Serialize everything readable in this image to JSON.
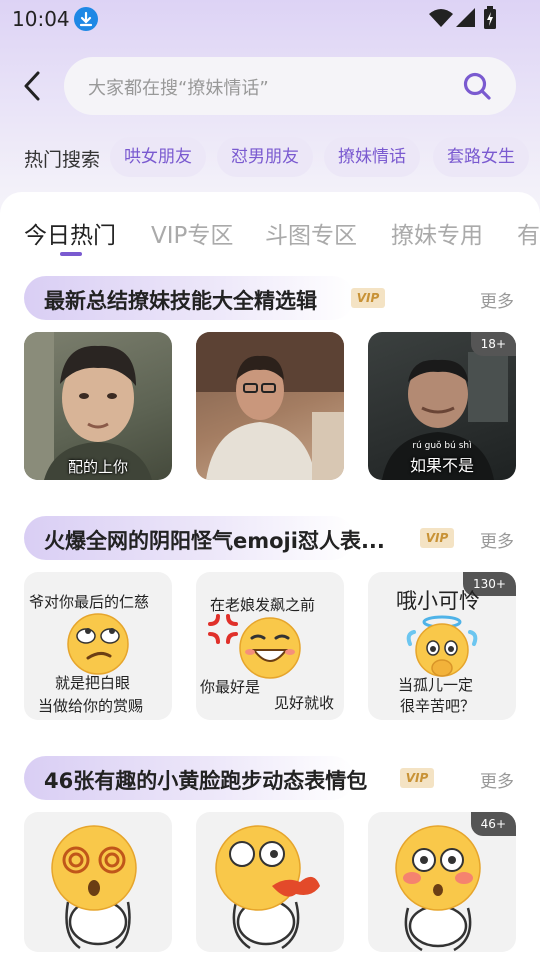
{
  "status": {
    "time": "10:04"
  },
  "search": {
    "placeholder": "大家都在搜“撩妹情话”"
  },
  "hot_search": {
    "label": "热门搜索",
    "tags": [
      "哄女朋友",
      "怼男朋友",
      "撩妹情话",
      "套路女生"
    ]
  },
  "tabs": [
    "今日热门",
    "VIP专区",
    "斗图专区",
    "撩妹专用",
    "有"
  ],
  "sections": [
    {
      "title": "最新总结撩妹技能大全精选辑",
      "vip": "VIP",
      "more": "更多",
      "thumbs": [
        {
          "caption": "配的上你"
        },
        {
          "caption": ""
        },
        {
          "caption": "如果不是",
          "pinyin": "rú   guǒ   bú   shì",
          "count": "18+"
        }
      ]
    },
    {
      "title": "火爆全网的阴阳怪气emoji怼人表...",
      "vip": "VIP",
      "more": "更多",
      "thumbs": [
        {
          "lines": [
            "爷对你最后的仁慈",
            "就是把白眼",
            "当做给你的赏赐"
          ]
        },
        {
          "lines": [
            "在老娘发飙之前",
            "你最好是",
            "见好就收"
          ]
        },
        {
          "lines": [
            "哦小可怜",
            "当孤儿一定",
            "很辛苦吧？"
          ],
          "count": "130+"
        }
      ]
    },
    {
      "title": "46张有趣的小黄脸跑步动态表情包",
      "vip": "VIP",
      "more": "更多",
      "thumbs": [
        {
          "caption": ""
        },
        {
          "caption": ""
        },
        {
          "caption": "",
          "count": "46+"
        }
      ]
    }
  ],
  "colors": {
    "accent": "#7a5ad0",
    "vip_gold": "#c89236",
    "emoji_yellow": "#f9c84a"
  }
}
